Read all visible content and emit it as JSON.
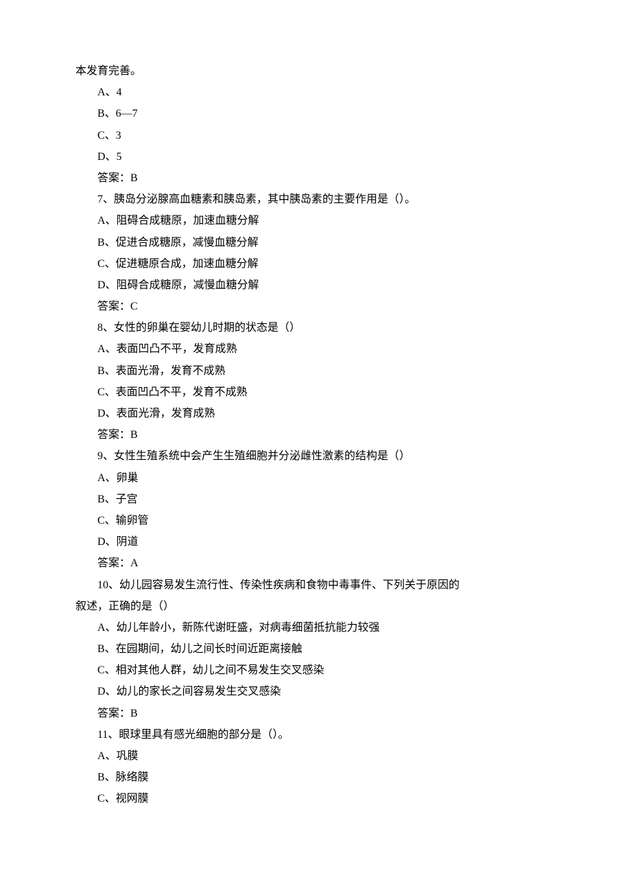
{
  "lines": [
    {
      "text": "本发育完善。",
      "indent": false
    },
    {
      "text": "A、4",
      "indent": true
    },
    {
      "text": "B、6—7",
      "indent": true
    },
    {
      "text": "C、3",
      "indent": true
    },
    {
      "text": "D、5",
      "indent": true
    },
    {
      "text": "答案：B",
      "indent": true
    },
    {
      "text": "7、胰岛分泌腺高血糖素和胰岛素，其中胰岛素的主要作用是（）。",
      "indent": true
    },
    {
      "text": "A、阻碍合成糖原，加速血糖分解",
      "indent": true
    },
    {
      "text": "B、促进合成糖原，减慢血糖分解",
      "indent": true
    },
    {
      "text": "C、促进糖原合成，加速血糖分解",
      "indent": true
    },
    {
      "text": "D、阻碍合成糖原，减慢血糖分解",
      "indent": true
    },
    {
      "text": "答案：C",
      "indent": true
    },
    {
      "text": "8、女性的卵巢在婴幼儿时期的状态是（）",
      "indent": true
    },
    {
      "text": "A、表面凹凸不平，发育成熟",
      "indent": true
    },
    {
      "text": "B、表面光滑，发育不成熟",
      "indent": true
    },
    {
      "text": "C、表面凹凸不平，发育不成熟",
      "indent": true
    },
    {
      "text": "D、表面光滑，发育成熟",
      "indent": true
    },
    {
      "text": "答案：B",
      "indent": true
    },
    {
      "text": "9、女性生殖系统中会产生生殖细胞并分泌雌性激素的结构是（）",
      "indent": true
    },
    {
      "text": "A、卵巢",
      "indent": true
    },
    {
      "text": "B、子宫",
      "indent": true
    },
    {
      "text": "C、输卵管",
      "indent": true
    },
    {
      "text": "D、阴道",
      "indent": true
    },
    {
      "text": "答案：A",
      "indent": true
    },
    {
      "text": "10、幼儿园容易发生流行性、传染性疾病和食物中毒事件、下列关于原因的",
      "indent": true
    },
    {
      "text": "叙述，正确的是（）",
      "indent": false
    },
    {
      "text": "A、幼儿年龄小，新陈代谢旺盛，对病毒细菌抵抗能力较强",
      "indent": true
    },
    {
      "text": "B、在园期间，幼儿之间长时间近距离接触",
      "indent": true
    },
    {
      "text": "C、相对其他人群，幼儿之间不易发生交叉感染",
      "indent": true
    },
    {
      "text": "D、幼儿的家长之间容易发生交叉感染",
      "indent": true
    },
    {
      "text": "答案：B",
      "indent": true
    },
    {
      "text": "11、眼球里具有感光细胞的部分是（）。",
      "indent": true
    },
    {
      "text": "A、巩膜",
      "indent": true
    },
    {
      "text": "B、脉络膜",
      "indent": true
    },
    {
      "text": "C、视网膜",
      "indent": true
    }
  ]
}
